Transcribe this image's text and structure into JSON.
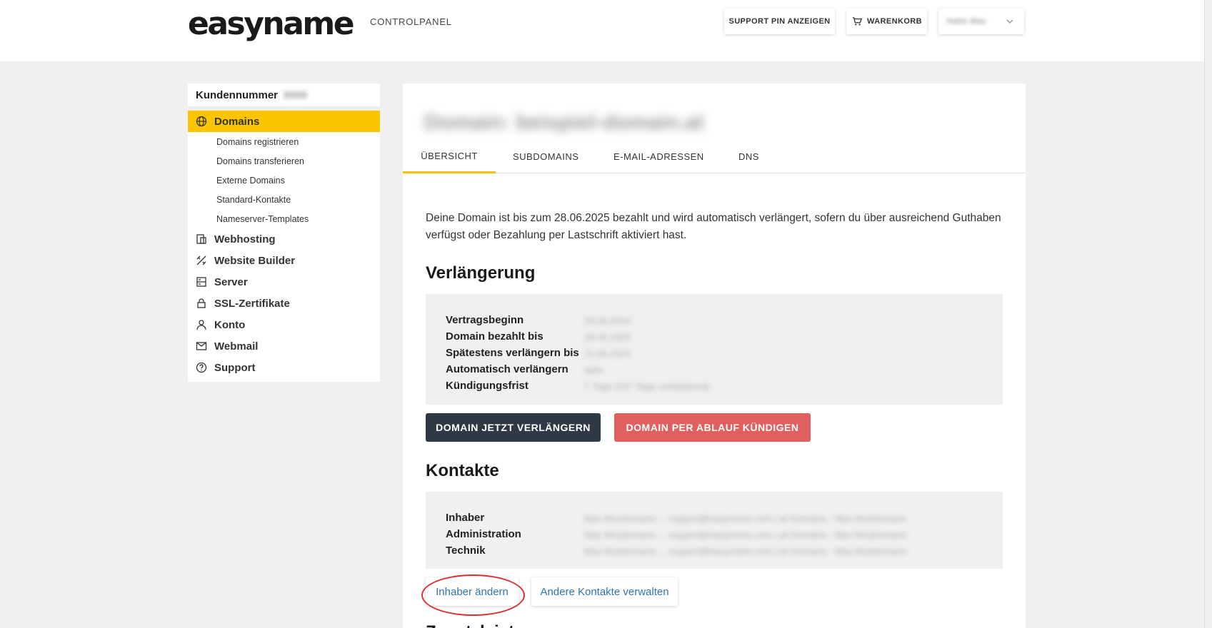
{
  "header": {
    "logo_text": "easyname",
    "logo_sub": "CONTROLPANEL",
    "support_pin": "SUPPORT PIN ANZEIGEN",
    "cart": "WARENKORB",
    "user": "Hallo Max"
  },
  "sidebar": {
    "kundennummer_label": "Kundennummer",
    "kundennummer_value": "0000",
    "items": [
      {
        "label": "Domains",
        "icon": "globe-icon",
        "active": true
      },
      {
        "label": "Webhosting",
        "icon": "webhosting-icon"
      },
      {
        "label": "Website Builder",
        "icon": "builder-icon"
      },
      {
        "label": "Server",
        "icon": "server-icon"
      },
      {
        "label": "SSL-Zertifikate",
        "icon": "lock-icon"
      },
      {
        "label": "Konto",
        "icon": "user-icon"
      },
      {
        "label": "Webmail",
        "icon": "mail-icon"
      },
      {
        "label": "Support",
        "icon": "help-icon"
      }
    ],
    "subitems": [
      "Domains registrieren",
      "Domains transferieren",
      "Externe Domains",
      "Standard-Kontakte",
      "Nameserver-Templates"
    ]
  },
  "main": {
    "title": "Domain: beispiel-domain.at",
    "tabs": [
      "ÜBERSICHT",
      "SUBDOMAINS",
      "E-MAIL-ADRESSEN",
      "DNS"
    ],
    "intro": "Deine Domain ist bis zum 28.06.2025 bezahlt und wird automatisch verlängert, sofern du über ausreichend Guthaben verfügst oder Bezahlung per Lastschrift aktiviert hast.",
    "renewal_heading": "Verlängerung",
    "renewal": [
      {
        "label": "Vertragsbeginn",
        "value": "28.06.2024"
      },
      {
        "label": "Domain bezahlt bis",
        "value": "28.06.2025"
      },
      {
        "label": "Spätestens verlängern bis",
        "value": "21.06.2025"
      },
      {
        "label": "Automatisch verlängern",
        "value": "aktiv"
      },
      {
        "label": "Kündigungsfrist",
        "value": "7 Tage (247 Tage verbleibend)"
      }
    ],
    "btn_renew": "DOMAIN JETZT VERLÄNGERN",
    "btn_cancel": "DOMAIN PER ABLAUF KÜNDIGEN",
    "contacts_heading": "Kontakte",
    "contacts": [
      {
        "label": "Inhaber",
        "value": "Max Mustermann ... support@easyname.com | at Domains - Max Mustermann"
      },
      {
        "label": "Administration",
        "value": "Max Mustermann ... support@easyname.com | at Domains - Max Mustermann"
      },
      {
        "label": "Technik",
        "value": "Max Mustermann ... support@easyname.com | at Domains - Max Mustermann"
      }
    ],
    "btn_owner": "Inhaber ändern",
    "btn_contacts": "Andere Kontakte verwalten",
    "next_heading": "Zusatzleistungen"
  }
}
